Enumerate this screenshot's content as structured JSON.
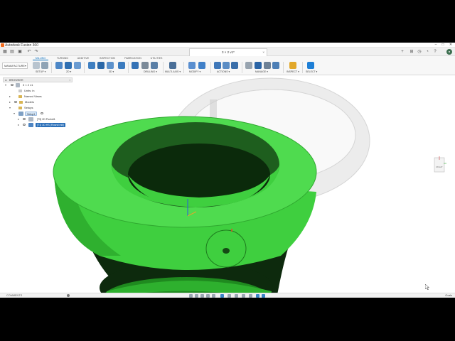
{
  "app": {
    "window_title": "Autodesk Fusion 360",
    "document_tab": "3 × 2 v1*",
    "window_controls": [
      "–",
      "□",
      "✕"
    ]
  },
  "ribbon": {
    "workspace": "MANUFACTURE",
    "tabs": [
      "MILLING",
      "TURNING",
      "ADDITIVE",
      "INSPECTION",
      "FABRICATION",
      "UTILITIES"
    ],
    "active_tab": "MILLING",
    "groups": [
      "SETUP ▾",
      "2D ▾",
      "3D ▾",
      "DRILLING ▾",
      "MULTI-AXIS ▾",
      "MODIFY ▾",
      "ACTIONS ▾",
      "MANAGE ▾",
      "INSPECT ▾",
      "SELECT ▾"
    ]
  },
  "browser": {
    "header": "BROWSER",
    "items": [
      {
        "label": "3 × 2 v1",
        "level": 0
      },
      {
        "label": "Units: in",
        "level": 1
      },
      {
        "label": "Named Views",
        "level": 1
      },
      {
        "label": "Models",
        "level": 1
      },
      {
        "label": "Setups",
        "level": 1
      },
      {
        "label": "Setup1",
        "level": 2
      },
      {
        "label": "[T5] 2D Pocket1",
        "level": 3
      },
      {
        "label": "[T1] 3D HS (Round mill)",
        "level": 3
      }
    ]
  },
  "viewcube": {
    "label": "RIGHT"
  },
  "bottom": {
    "comments": "COMMENTS",
    "status": "Ovals"
  },
  "colors": {
    "model_green": "#33cc33",
    "accent_blue": "#0a6fbd",
    "selection_blue": "#2a6fb8"
  }
}
